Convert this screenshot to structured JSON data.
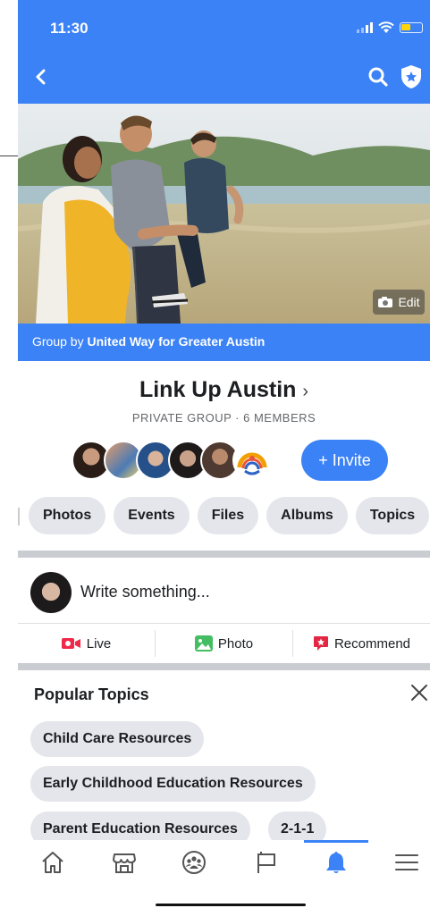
{
  "status_bar": {
    "time": "11:30"
  },
  "cover": {
    "edit_label": "Edit"
  },
  "group": {
    "by_prefix": "Group by ",
    "by_org": "United Way for Greater Austin",
    "name": "Link Up Austin",
    "meta": "PRIVATE GROUP · 6 MEMBERS",
    "invite_label": "+ Invite"
  },
  "tabs": [
    "Photos",
    "Events",
    "Files",
    "Albums",
    "Topics"
  ],
  "composer": {
    "placeholder": "Write something..."
  },
  "actions": {
    "live": "Live",
    "photo": "Photo",
    "recommend": "Recommend"
  },
  "popular_topics": {
    "title": "Popular Topics",
    "items": [
      "Child Care Resources",
      "Early Childhood Education Resources",
      "Parent Education Resources",
      "2-1-1"
    ]
  },
  "bottom_nav": [
    "home-icon",
    "marketplace-icon",
    "groups-icon",
    "pages-flag-icon",
    "notifications-bell-icon",
    "menu-icon"
  ],
  "colors": {
    "brand_blue": "#3b82f6",
    "chip_gray": "#e4e6eb",
    "divider": "#c9ccd1"
  }
}
